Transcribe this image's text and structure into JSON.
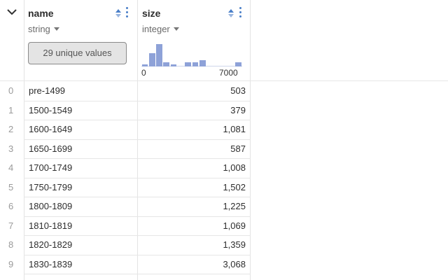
{
  "header": {
    "columns": [
      {
        "title": "name",
        "type": "string",
        "unique_label": "29 unique values"
      },
      {
        "title": "size",
        "type": "integer",
        "histogram": {
          "min_label": "0",
          "max_label": "7000",
          "bins": [
            0.08,
            0.5,
            0.85,
            0.15,
            0.08,
            0,
            0.15,
            0.15,
            0.25,
            0,
            0,
            0,
            0,
            0.15
          ]
        }
      }
    ]
  },
  "rows": [
    {
      "index": "0",
      "name": "pre-1499",
      "size": "503"
    },
    {
      "index": "1",
      "name": "1500-1549",
      "size": "379"
    },
    {
      "index": "2",
      "name": "1600-1649",
      "size": "1,081"
    },
    {
      "index": "3",
      "name": "1650-1699",
      "size": "587"
    },
    {
      "index": "4",
      "name": "1700-1749",
      "size": "1,008"
    },
    {
      "index": "5",
      "name": "1750-1799",
      "size": "1,502"
    },
    {
      "index": "6",
      "name": "1800-1809",
      "size": "1,225"
    },
    {
      "index": "7",
      "name": "1810-1819",
      "size": "1,069"
    },
    {
      "index": "8",
      "name": "1820-1829",
      "size": "1,359"
    },
    {
      "index": "9",
      "name": "1830-1839",
      "size": "3,068"
    }
  ],
  "colors": {
    "accent": "#4a7fc8",
    "histogram": "#8ea2d8"
  }
}
